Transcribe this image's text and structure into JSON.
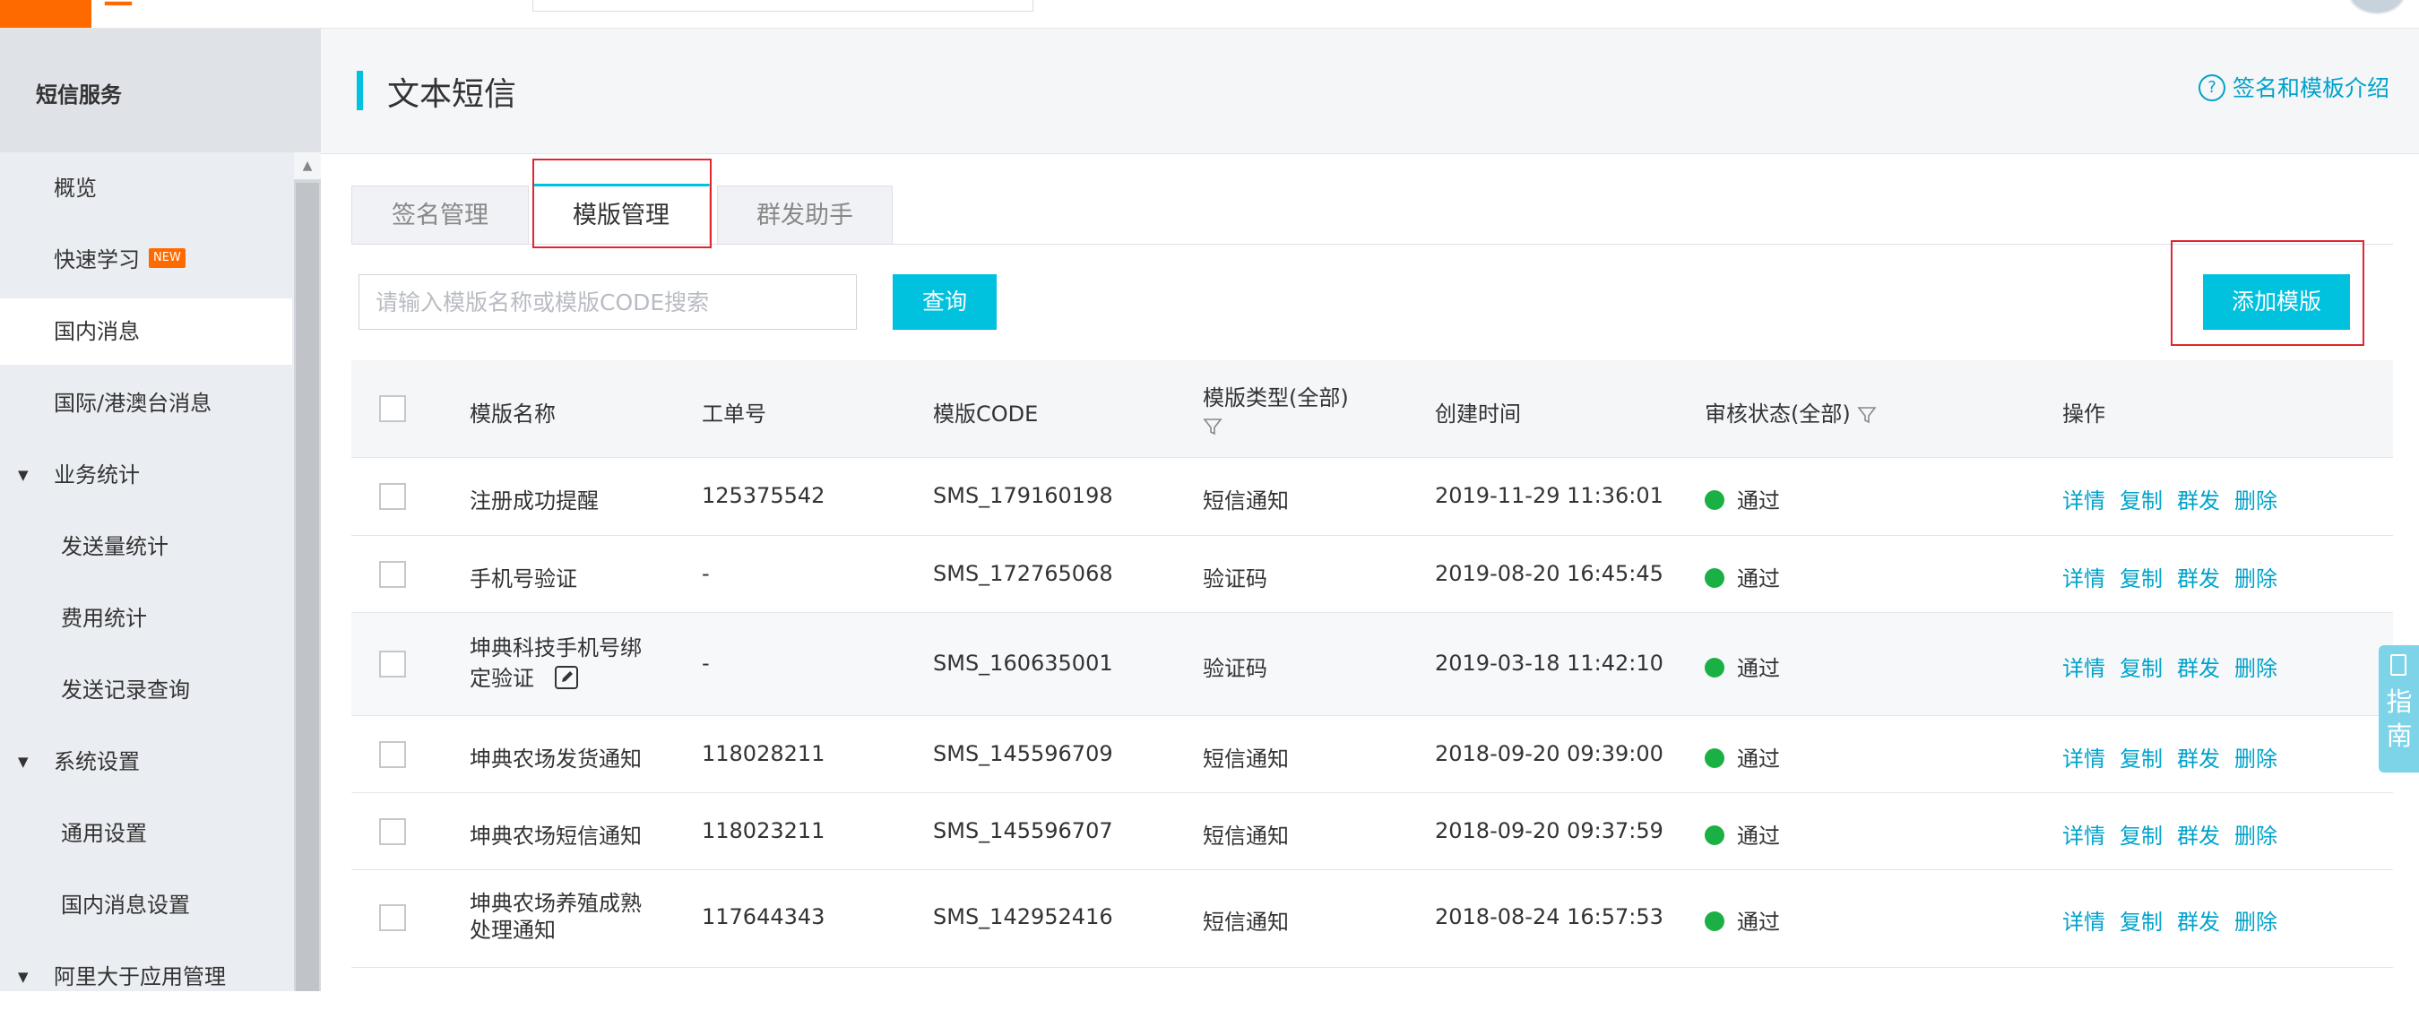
{
  "sidebar": {
    "header": "短信服务",
    "items": [
      {
        "label": "概览"
      },
      {
        "label": "快速学习",
        "badge": "NEW"
      },
      {
        "label": "国内消息"
      },
      {
        "label": "国际/港澳台消息"
      },
      {
        "label": "业务统计"
      },
      {
        "label": "发送量统计"
      },
      {
        "label": "费用统计"
      },
      {
        "label": "发送记录查询"
      },
      {
        "label": "系统设置"
      },
      {
        "label": "通用设置"
      },
      {
        "label": "国内消息设置"
      },
      {
        "label": "阿里大于应用管理"
      }
    ]
  },
  "header": {
    "title": "文本短信",
    "help_link": "签名和模板介绍"
  },
  "tabs": [
    {
      "label": "签名管理"
    },
    {
      "label": "模版管理"
    },
    {
      "label": "群发助手"
    }
  ],
  "search": {
    "placeholder": "请输入模版名称或模版CODE搜索",
    "button": "查询"
  },
  "add_button": "添加模版",
  "table": {
    "columns": {
      "name": "模版名称",
      "order": "工单号",
      "code": "模版CODE",
      "type": "模版类型(全部)",
      "created": "创建时间",
      "status": "审核状态(全部)",
      "ops": "操作"
    },
    "actions": [
      "详情",
      "复制",
      "群发",
      "删除"
    ],
    "rows": [
      {
        "name1": "注册成功提醒",
        "name2": "",
        "order": "125375542",
        "code": "SMS_179160198",
        "type": "短信通知",
        "created": "2019-11-29 11:36:01",
        "status": "通过"
      },
      {
        "name1": "手机号验证",
        "name2": "",
        "order": "-",
        "code": "SMS_172765068",
        "type": "验证码",
        "created": "2019-08-20 16:45:45",
        "status": "通过"
      },
      {
        "name1": "坤典科技手机号绑",
        "name2": "定验证",
        "order": "-",
        "code": "SMS_160635001",
        "type": "验证码",
        "created": "2019-03-18 11:42:10",
        "status": "通过"
      },
      {
        "name1": "坤典农场发货通知",
        "name2": "",
        "order": "118028211",
        "code": "SMS_145596709",
        "type": "短信通知",
        "created": "2018-09-20 09:39:00",
        "status": "通过"
      },
      {
        "name1": "坤典农场短信通知",
        "name2": "",
        "order": "118023211",
        "code": "SMS_145596707",
        "type": "短信通知",
        "created": "2018-09-20 09:37:59",
        "status": "通过"
      },
      {
        "name1": "坤典农场养殖成熟",
        "name2": "处理通知",
        "order": "117644343",
        "code": "SMS_142952416",
        "type": "短信通知",
        "created": "2018-08-24 16:57:53",
        "status": "通过"
      }
    ]
  },
  "guide": {
    "label": "指南"
  },
  "colors": {
    "accent": "#00c1de",
    "link": "#00a2ca",
    "brand": "#ff6a00",
    "status_ok": "#1bb043",
    "highlight": "#e0262e"
  }
}
